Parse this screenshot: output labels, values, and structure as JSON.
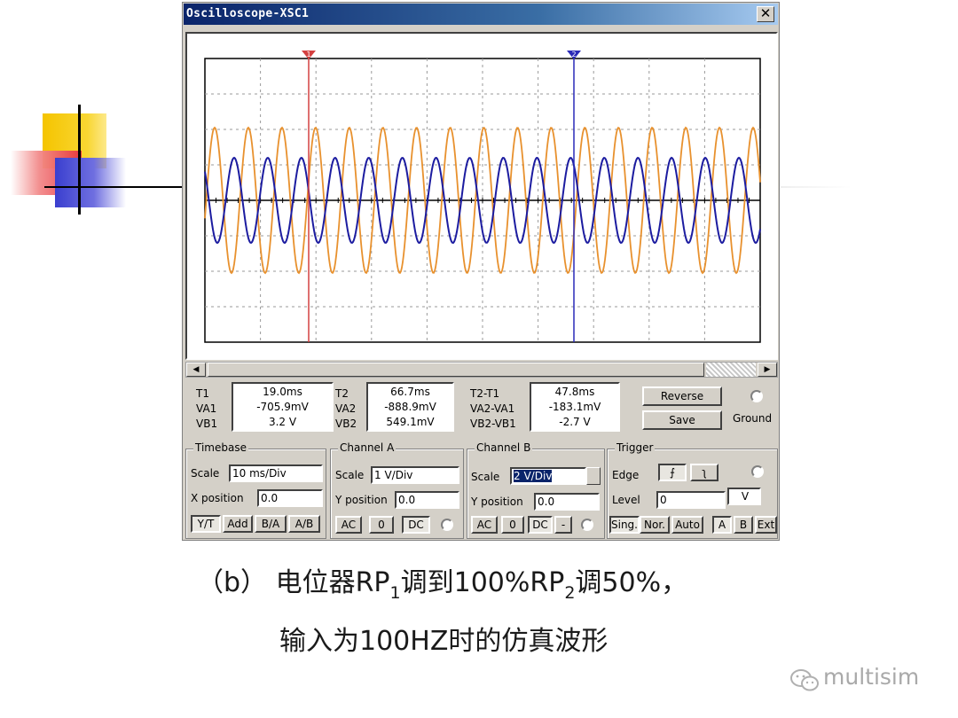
{
  "window": {
    "title": "Oscilloscope-XSC1",
    "close_glyph": "✕"
  },
  "display": {
    "channel_a_color": "#e8912e",
    "channel_b_color": "#1c1ca0",
    "cursor_1": {
      "label": "1",
      "color": "#d44040"
    },
    "cursor_2": {
      "label": "2",
      "color": "#2a2ab8"
    }
  },
  "readouts": {
    "t1": {
      "labels": [
        "T1",
        "VA1",
        "VB1"
      ],
      "values": [
        "19.0ms",
        "-705.9mV",
        "3.2 V"
      ]
    },
    "t2": {
      "labels": [
        "T2",
        "VA2",
        "VB2"
      ],
      "values": [
        "66.7ms",
        "-888.9mV",
        "549.1mV"
      ]
    },
    "diff": {
      "labels": [
        "T2-T1",
        "VA2-VA1",
        "VB2-VB1"
      ],
      "values": [
        "47.8ms",
        "-183.1mV",
        "-2.7 V"
      ]
    },
    "reverse_label": "Reverse",
    "save_label": "Save",
    "ground_label": "Ground"
  },
  "timebase": {
    "title": "Timebase",
    "scale_label": "Scale",
    "scale_value": "10 ms/Div",
    "xpos_label": "X position",
    "xpos_value": "0.0",
    "modes": [
      "Y/T",
      "Add",
      "B/A",
      "A/B"
    ]
  },
  "channel_a": {
    "title": "Channel A",
    "scale_label": "Scale",
    "scale_value": "1 V/Div",
    "ypos_label": "Y position",
    "ypos_value": "0.0",
    "coupling": [
      "AC",
      "0",
      "DC"
    ]
  },
  "channel_b": {
    "title": "Channel B",
    "scale_label": "Scale",
    "scale_value": "2 V/Div",
    "ypos_label": "Y position",
    "ypos_value": "0.0",
    "coupling": [
      "AC",
      "0",
      "DC",
      "-"
    ]
  },
  "trigger": {
    "title": "Trigger",
    "edge_label": "Edge",
    "edge_rise": "⨍",
    "edge_fall": "ʅ",
    "level_label": "Level",
    "level_value": "0",
    "level_unit": "V",
    "modes": [
      "Sing.",
      "Nor.",
      "Auto"
    ],
    "sources": [
      "A",
      "B",
      "Ext"
    ]
  },
  "caption": {
    "line1_a": "（b） 电位器RP",
    "line1_sub1": "1",
    "line1_b": "调到100%RP",
    "line1_sub2": "2",
    "line1_c": "调50%，",
    "line2": "输入为100HZ时的仿真波形"
  },
  "watermark": {
    "text": "multisim",
    "icon": "wechat-icon"
  }
}
